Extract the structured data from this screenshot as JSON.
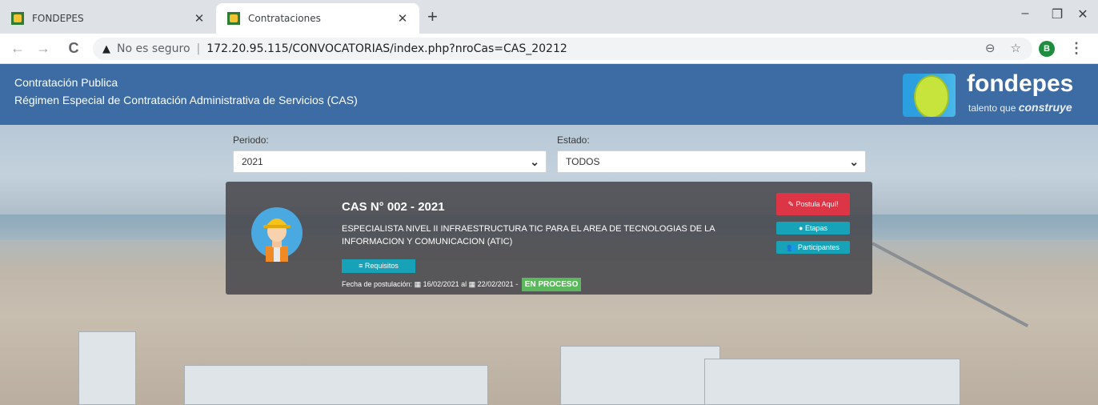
{
  "browser": {
    "tabs": [
      {
        "title": "FONDEPES",
        "active": false
      },
      {
        "title": "Contrataciones",
        "active": true
      }
    ],
    "new_tab": "+",
    "window_controls": [
      "–",
      "❐",
      "✕"
    ],
    "address": {
      "security_label": "No es seguro",
      "separator": "|",
      "url": "172.20.95.115/CONVOCATORIAS/index.php?nroCas=CAS_20212"
    },
    "profile_initial": "B"
  },
  "header": {
    "line1": "Contratación Publica",
    "line2": "Régimen Especial de Contratación Administrativa de Servicios (CAS)",
    "logo_name": "fondepes",
    "logo_tagline_prefix": "talento que ",
    "logo_tagline_emphasis": "construye"
  },
  "filters": {
    "periodo": {
      "label": "Periodo:",
      "value": "2021"
    },
    "estado": {
      "label": "Estado:",
      "value": "TODOS"
    }
  },
  "convocatoria": {
    "title": "CAS N° 002 - 2021",
    "description": "ESPECIALISTA NIVEL II INFRAESTRUCTURA TIC PARA EL AREA DE TECNOLOGIAS DE LA INFORMACION Y COMUNICACION (ATIC)",
    "requisitos_label": "≡ Requisitos",
    "dates_prefix": "Fecha de postulación: ",
    "date_start": "▦ 16/02/2021",
    "date_connector": " al ",
    "date_end": "▦ 22/02/2021",
    "dates_suffix": " - ",
    "status": "EN PROCESO",
    "apply_label": "✎ Postula Aquí!",
    "etapas_label": "● Etapas",
    "participantes_label": "👥 Participantes"
  },
  "colors": {
    "header_bg": "#3d6ba3",
    "apply_button": "#dc3545",
    "teal_button": "#17a2b8",
    "status_badge": "#5cb85c"
  }
}
